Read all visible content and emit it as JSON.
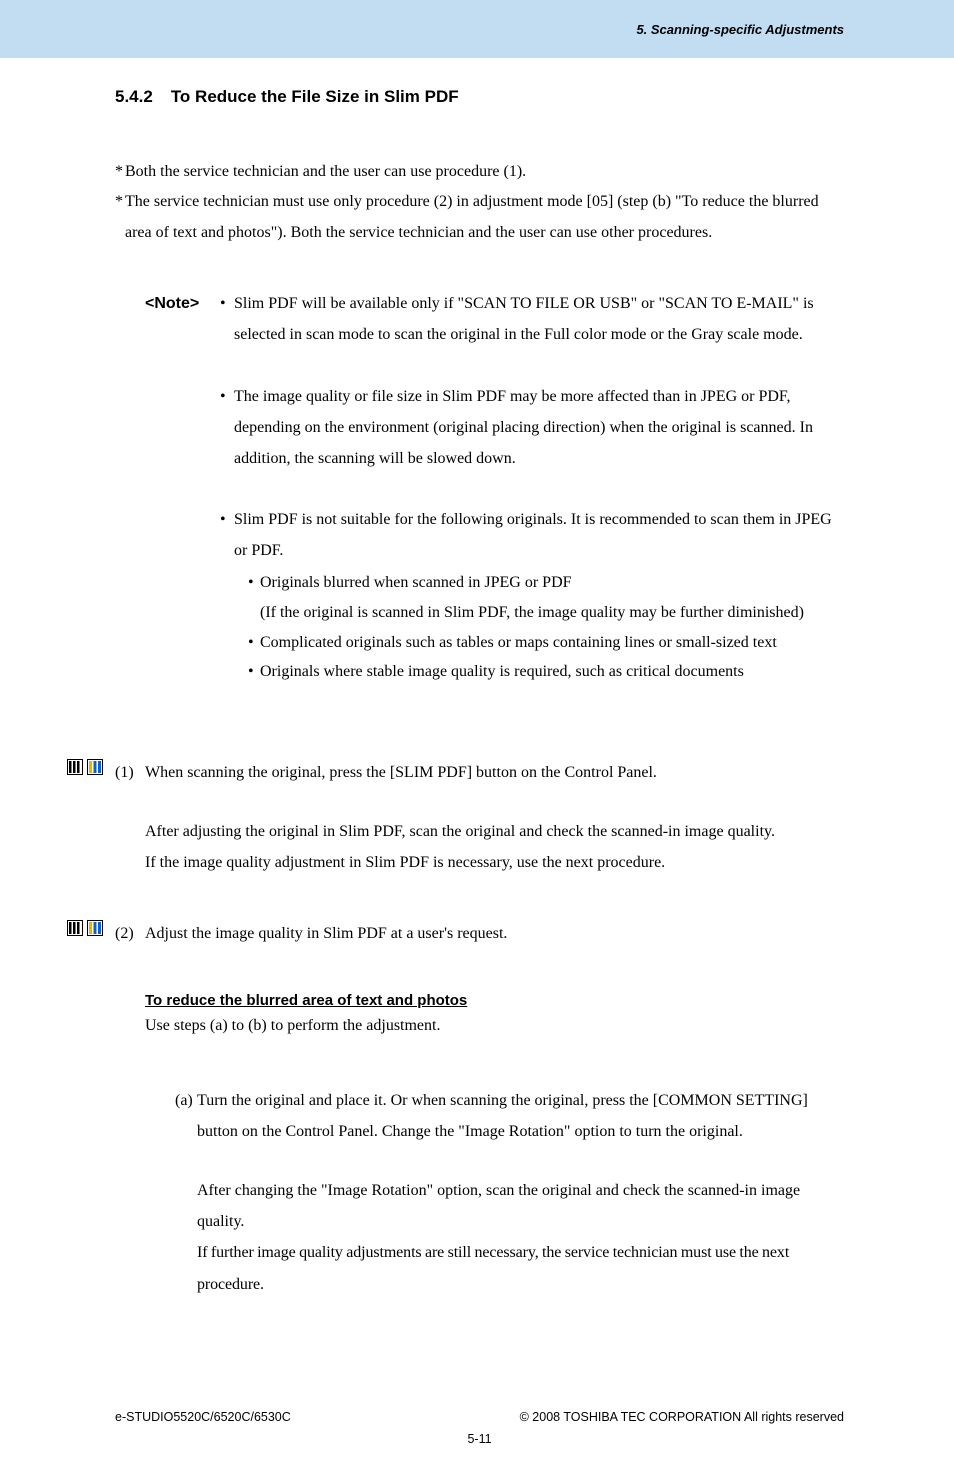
{
  "header": {
    "chapter": "5. Scanning-specific Adjustments"
  },
  "section": {
    "number": "5.4.2",
    "title": "To Reduce the File Size in Slim PDF"
  },
  "intro": {
    "line1": "Both the service technician and the user can use procedure (1).",
    "line2a": "The service technician must use only procedure (2) in adjustment mode [05] (step (b) \"To reduce the blurred",
    "line2b": "area of text and photos\").  Both the service technician and the user can use other procedures."
  },
  "note": {
    "label": "<Note>",
    "items": [
      "Slim PDF will be available only if \"SCAN TO FILE OR USB\" or \"SCAN TO E-MAIL\" is selected in scan mode to scan the original in the Full color mode or the Gray scale mode.",
      "The image quality or file size in Slim PDF may be more affected than in JPEG or PDF, depending on the environment (original placing direction) when the original is scanned.  In addition, the scanning will be slowed down.",
      "Slim PDF is not suitable for the following originals.  It is recommended to scan them in JPEG or PDF."
    ],
    "sub": {
      "a": "Originals blurred when scanned in JPEG or PDF",
      "a_paren": "(If the original is scanned in Slim PDF, the image quality may be further diminished)",
      "b": "Complicated originals such as tables or maps containing lines or small-sized text",
      "c": "Originals where stable image quality is required, such as critical documents"
    }
  },
  "proc1": {
    "num": "(1)",
    "text": "When scanning the original, press the [SLIM PDF] button on the Control Panel.",
    "after1": "After adjusting the original in Slim PDF, scan the original and check the scanned-in image quality.",
    "after2": "If the image quality adjustment in Slim PDF is necessary, use the next procedure."
  },
  "proc2": {
    "num": "(2)",
    "text": "Adjust the image quality in Slim PDF at a user's request.",
    "subhead": "To reduce the blurred area of text and photos",
    "subintro": "Use steps (a) to (b) to perform the adjustment.",
    "step_a_label": "(a)",
    "step_a": "Turn the original and place it.  Or when scanning the original, press the [COMMON SETTING] button on the Control Panel.  Change the \"Image Rotation\" option to turn the original.",
    "step_a_after1": "After changing the \"Image Rotation\" option, scan the original and check the scanned-in image quality.",
    "step_a_after2": "If further image quality adjustments are still necessary, the service technician must use the next procedure."
  },
  "footer": {
    "left": "e-STUDIO5520C/6520C/6530C",
    "right": "© 2008 TOSHIBA TEC CORPORATION All rights reserved",
    "page": "5-11"
  },
  "glyphs": {
    "star": "*",
    "bullet": "•"
  }
}
